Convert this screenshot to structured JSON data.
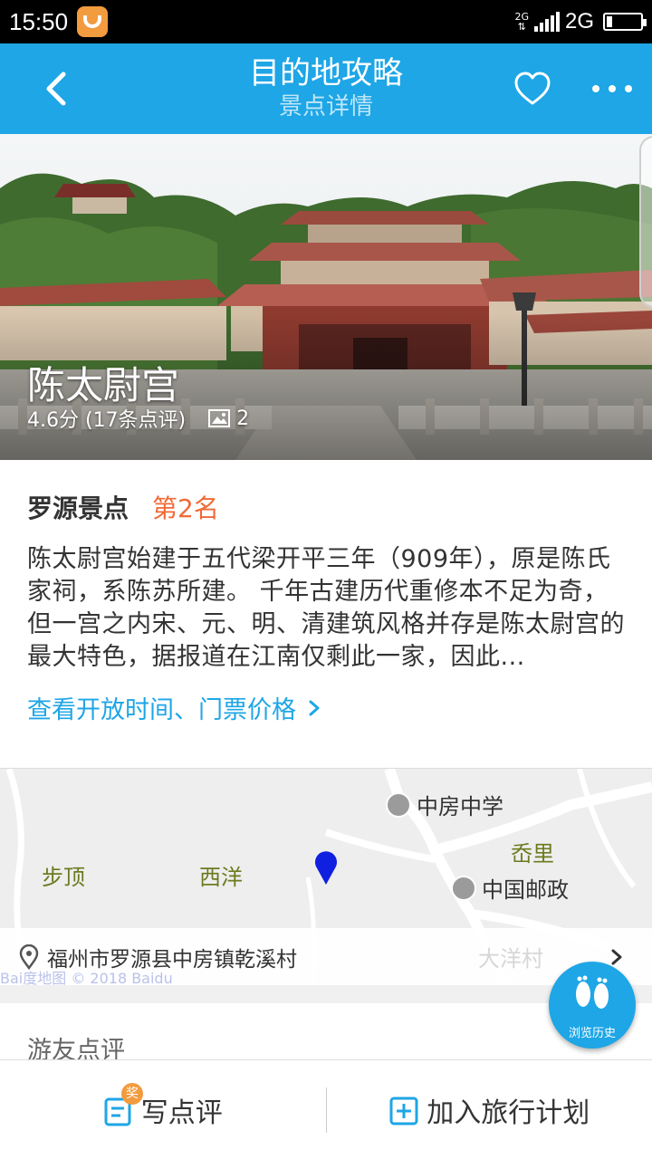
{
  "status_bar": {
    "time": "15:50",
    "signal_small": "2G",
    "network": "2G"
  },
  "nav": {
    "title": "目的地攻略",
    "subtitle": "景点详情"
  },
  "hero": {
    "name": "陈太尉宫",
    "rating_text": "4.6分 (17条点评)",
    "photo_count": "2"
  },
  "intro": {
    "category": "罗源景点",
    "rank": "第2名",
    "description": "陈太尉宫始建于五代梁开平三年（909年），原是陈氏家祠，系陈苏所建。 千年古建历代重修本不足为奇，但一宫之内宋、元、明、清建筑风格并存是陈太尉宫的最大特色，据报道在江南仅剩此一家，因此...",
    "link": "查看开放时间、门票价格"
  },
  "map": {
    "labels": {
      "buding": "步顶",
      "xiyang": "西洋",
      "xianli": "岙里",
      "dayangcun": "大洋村"
    },
    "pois": {
      "school": "中房中学",
      "post": "中国邮政"
    },
    "address": "福州市罗源县中房镇乾溪村",
    "watermark": "Bai度地图 © 2018 Baidu"
  },
  "reviews": {
    "heading": "游友点评"
  },
  "history": {
    "label": "浏览历史"
  },
  "bottom": {
    "write_review": "写点评",
    "add_plan": "加入旅行计划",
    "badge": "奖"
  },
  "colors": {
    "primary": "#1ea6e6",
    "rank": "#f06a35",
    "badge": "#f29b3f"
  }
}
